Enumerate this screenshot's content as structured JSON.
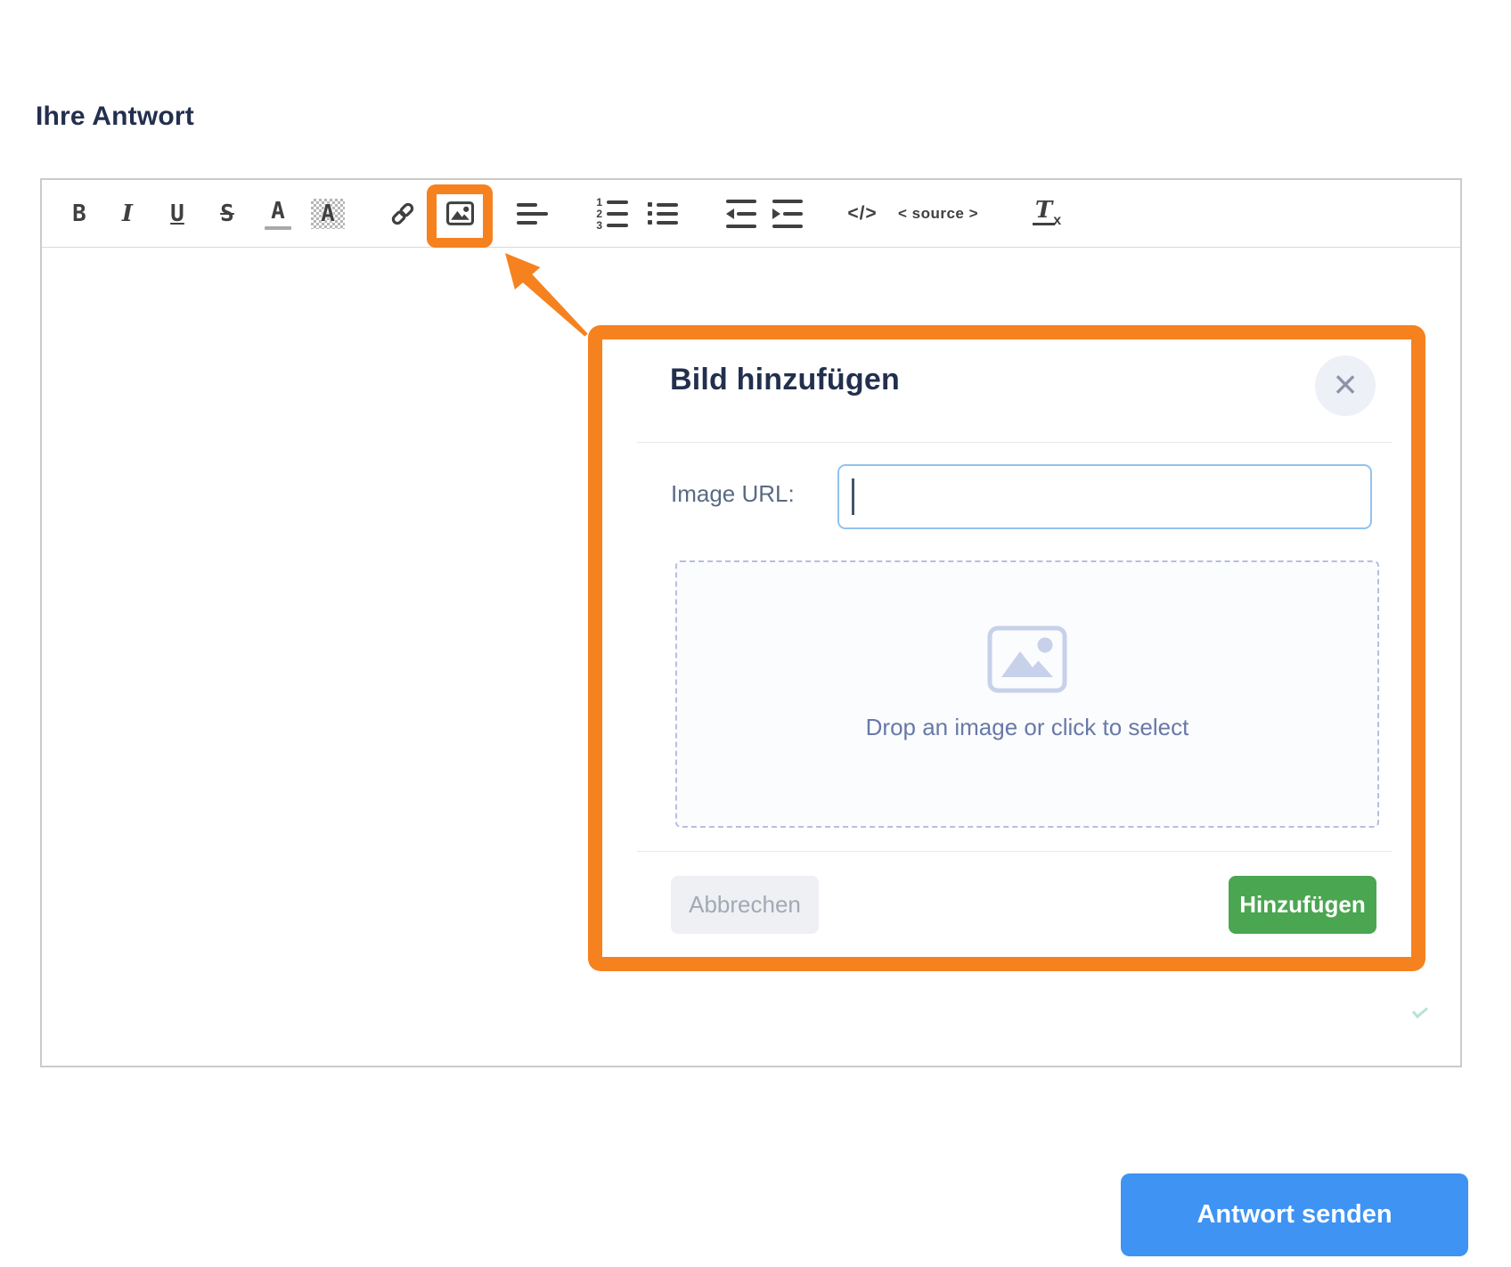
{
  "page": {
    "heading": "Ihre Antwort"
  },
  "toolbar": {
    "bold": "B",
    "italic": "I",
    "underline": "U",
    "strikethrough": "S",
    "font_color": "A",
    "background_color": "A",
    "code": "</>",
    "source": "< source >",
    "clear_format_main": "T",
    "clear_format_sub": "x",
    "ordered_list_numbers": [
      "1",
      "2",
      "3"
    ]
  },
  "modal": {
    "title": "Bild hinzufügen",
    "close_glyph": "×",
    "url_label": "Image URL:",
    "url_value": "",
    "dropzone_text": "Drop an image or click to select",
    "cancel_label": "Abbrechen",
    "add_label": "Hinzufügen"
  },
  "actions": {
    "send_label": "Antwort senden"
  },
  "colors": {
    "accent_orange": "#F5821F",
    "add_green": "#4AA650",
    "send_blue": "#3E93F3",
    "title_navy": "#232F4E",
    "dropzone_blue_gray": "#6879A8"
  }
}
